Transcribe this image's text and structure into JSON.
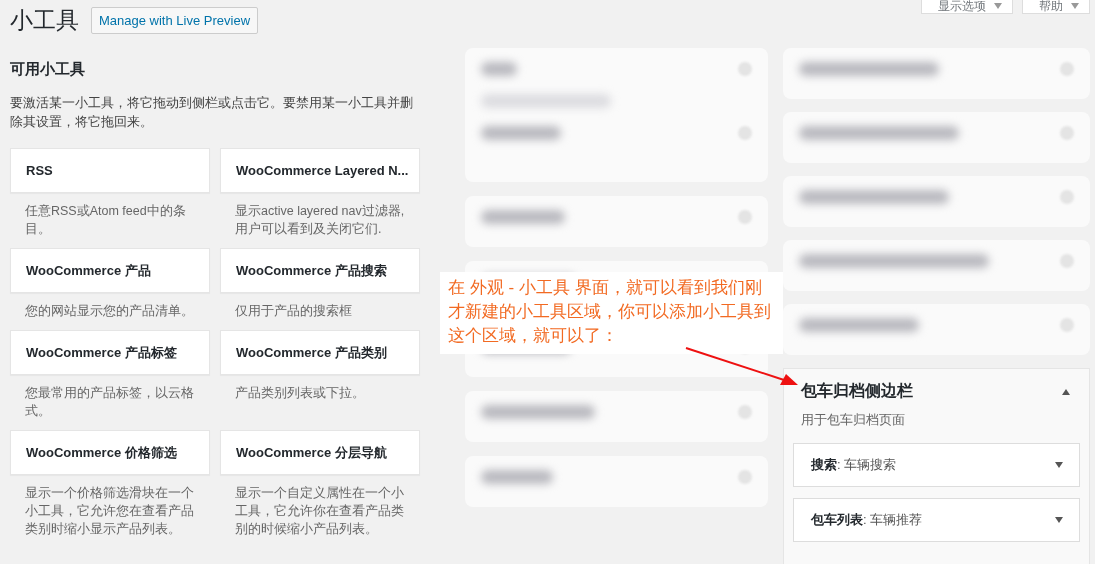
{
  "page": {
    "title": "小工具",
    "live_preview_button": "Manage with Live Preview",
    "top_buttons": [
      {
        "label": "显示选项"
      },
      {
        "label": "帮助"
      }
    ]
  },
  "available_widgets": {
    "title": "可用小工具",
    "description": "要激活某一小工具，将它拖动到侧栏或点击它。要禁用某一小工具并删除其设置，将它拖回来。",
    "widgets": [
      {
        "title": "RSS",
        "description": "任意RSS或Atom feed中的条目。"
      },
      {
        "title": "WooCommerce Layered N...",
        "description": "显示active layered nav过滤器,用户可以看到及关闭它们."
      },
      {
        "title": "WooCommerce 产品",
        "description": "您的网站显示您的产品清单。"
      },
      {
        "title": "WooCommerce 产品搜索",
        "description": "仅用于产品的搜索框"
      },
      {
        "title": "WooCommerce 产品标签",
        "description": "您最常用的产品标签，以云格式。"
      },
      {
        "title": "WooCommerce 产品类别",
        "description": "产品类别列表或下拉。"
      },
      {
        "title": "WooCommerce 价格筛选",
        "description": "显示一个价格筛选滑块在一个小工具，它允许您在查看产品类别时缩小显示产品列表。"
      },
      {
        "title": "WooCommerce 分层导航",
        "description": "显示一个自定义属性在一个小工具，它允许你在查看产品类别的时候缩小产品列表。"
      }
    ]
  },
  "sidebar": {
    "title": "包车归档侧边栏",
    "expanded": true,
    "description": "用于包车归档页面",
    "widgets": [
      {
        "label": "**搜索**: 车辆搜索",
        "expanded": false
      },
      {
        "label": "**包车列表**: 车辆推荐",
        "expanded": false
      }
    ]
  },
  "annotation": {
    "text": "在 外观 - 小工具 界面，就可以看到我们刚才新建的小工具区域，你可以添加小工具到这个区域，就可以了："
  }
}
